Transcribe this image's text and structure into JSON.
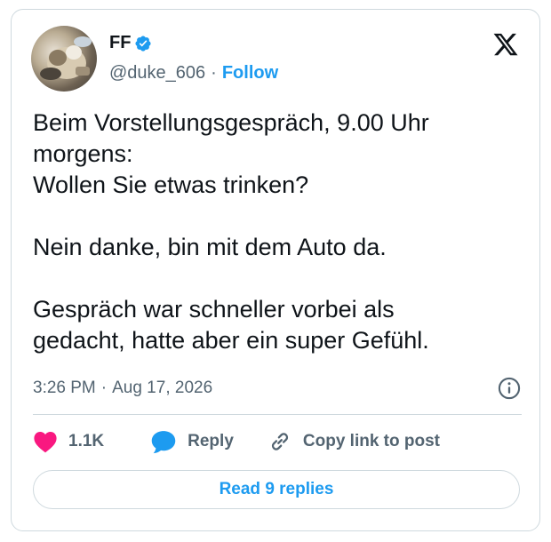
{
  "author": {
    "name": "FF",
    "handle": "@duke_606",
    "separator": "·",
    "follow_label": "Follow",
    "avatar_icon": "profile-photo",
    "verified_icon": "verified-badge-icon"
  },
  "brand_logo": "x-logo-icon",
  "tweet": {
    "text": "Beim Vorstellungsgespräch, 9.00 Uhr\nmorgens:\nWollen Sie etwas trinken?\n\nNein danke, bin mit dem Auto da.\n\nGespräch war schneller vorbei als\ngedacht, hatte aber ein super Gefühl."
  },
  "meta": {
    "time": "3:26 PM",
    "separator": "·",
    "date": "Aug 17, 2026",
    "info_icon": "info-icon"
  },
  "actions": {
    "likes_count": "1.1K",
    "reply_label": "Reply",
    "copy_link_label": "Copy link to post"
  },
  "read_replies_label": "Read 9 replies",
  "colors": {
    "accent": "#1d9bf0",
    "like": "#f91880",
    "text": "#0f1419",
    "muted": "#536471",
    "border": "#cfd9de"
  }
}
